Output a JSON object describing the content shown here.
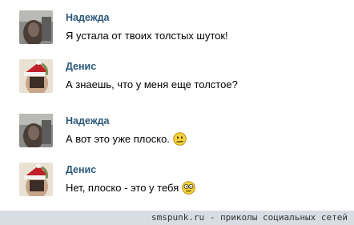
{
  "messages": [
    {
      "author": "Надежда",
      "text": "Я устала от твоих толстых шуток!",
      "avatar": "nadezhda-avatar",
      "emoji": ""
    },
    {
      "author": "Денис",
      "text": "А знаешь, что у меня еще толстое?",
      "avatar": "denis-avatar",
      "emoji": ""
    },
    {
      "author": "Надежда",
      "text": "А вот это уже плоско.",
      "avatar": "nadezhda-avatar",
      "emoji": "frown-smiley-icon"
    },
    {
      "author": "Денис",
      "text": "Нет, плоско - это у тебя",
      "avatar": "denis-avatar",
      "emoji": "shocked-smiley-icon"
    }
  ],
  "footer": {
    "text": "smspunk.ru - приколы социальных сетей"
  }
}
